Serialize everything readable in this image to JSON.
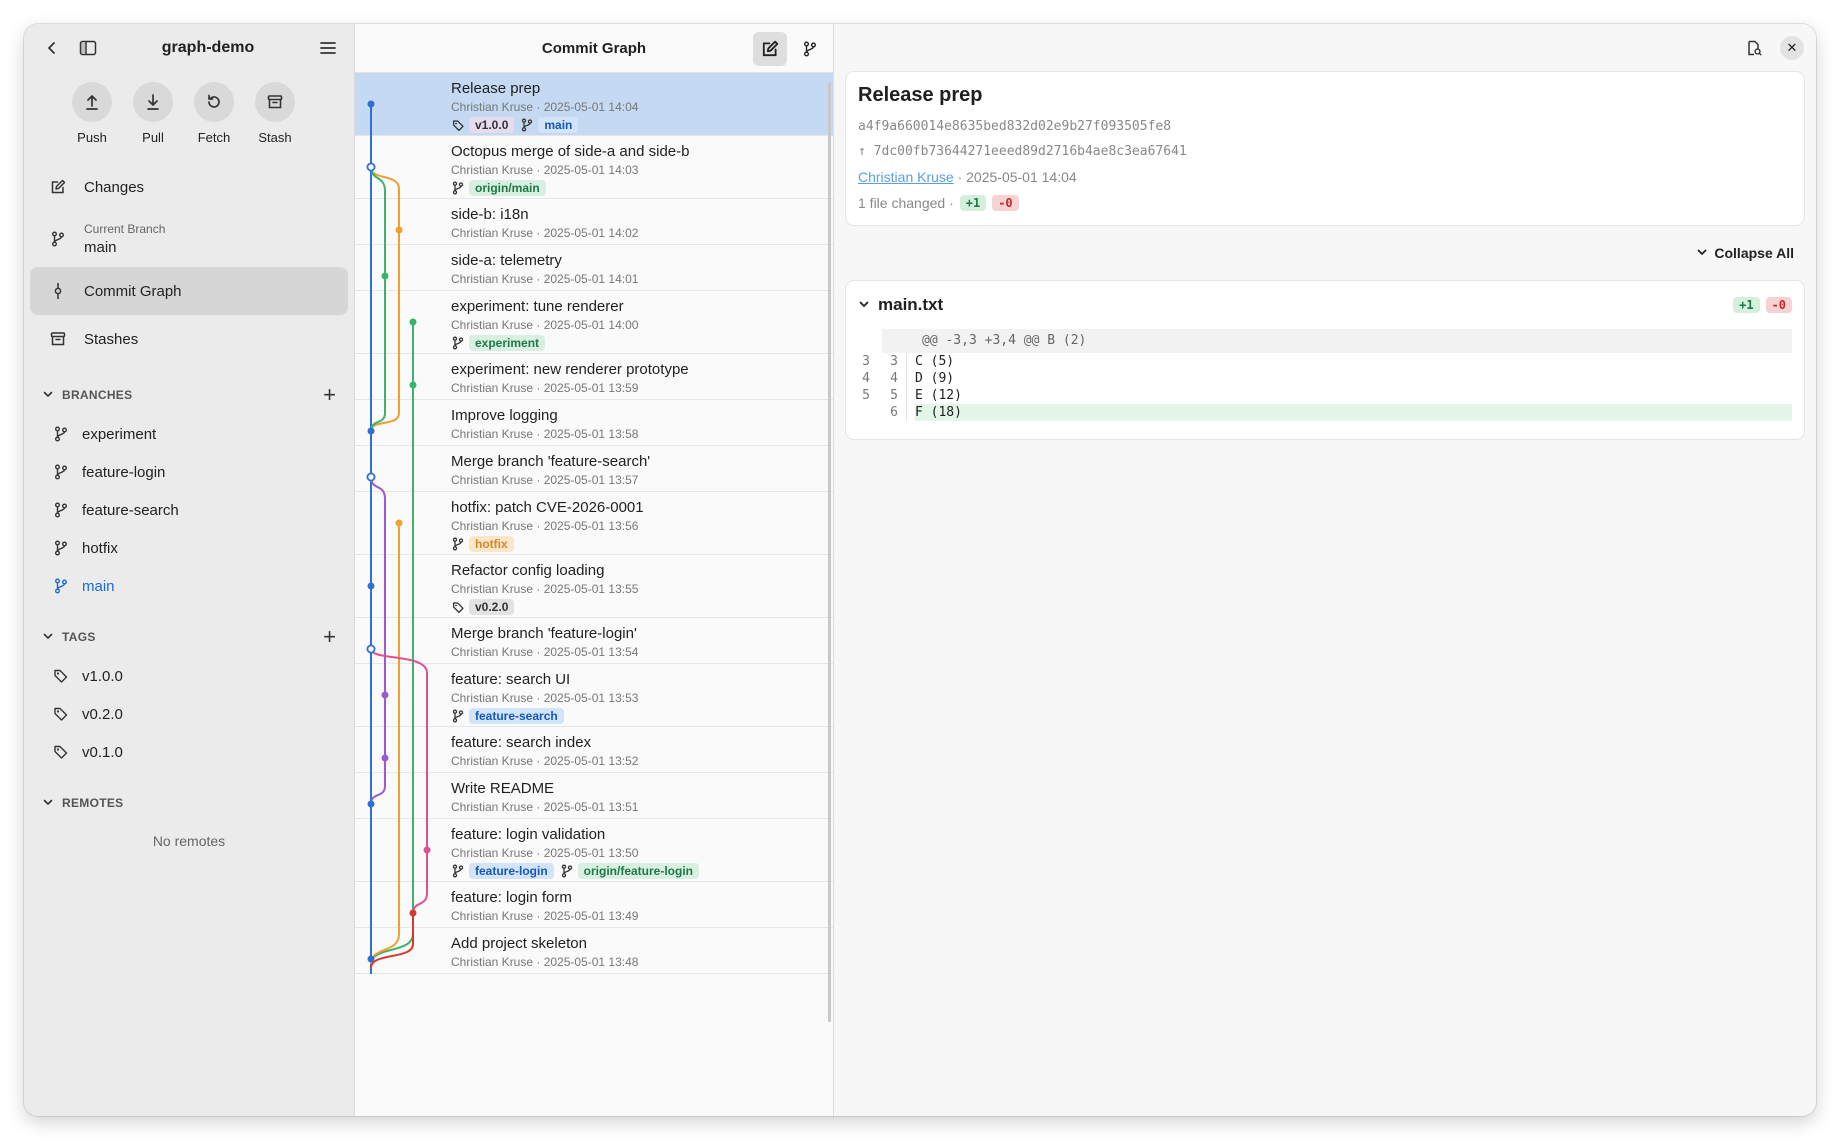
{
  "sidebar": {
    "repo_name": "graph-demo",
    "actions": [
      {
        "label": "Push",
        "icon": "push-icon"
      },
      {
        "label": "Pull",
        "icon": "pull-icon"
      },
      {
        "label": "Fetch",
        "icon": "fetch-icon"
      },
      {
        "label": "Stash",
        "icon": "stash-icon"
      }
    ],
    "nav": {
      "changes": "Changes",
      "current_branch_caption": "Current Branch",
      "current_branch": "main",
      "commit_graph": "Commit Graph",
      "stashes": "Stashes"
    },
    "branches_header": "BRANCHES",
    "branches": [
      "experiment",
      "feature-login",
      "feature-search",
      "hotfix",
      "main"
    ],
    "tags_header": "TAGS",
    "tags": [
      "v1.0.0",
      "v0.2.0",
      "v0.1.0"
    ],
    "remotes_header": "REMOTES",
    "no_remotes": "No remotes"
  },
  "graph": {
    "title": "Commit Graph",
    "commits": [
      {
        "title": "Release prep",
        "meta": "Christian Kruse · 2025-05-01 14:04",
        "refs": [
          {
            "kind": "tag",
            "name": "v1.0.0",
            "style": "purple"
          },
          {
            "kind": "branch",
            "name": "main",
            "style": "blue"
          }
        ]
      },
      {
        "title": "Octopus merge of side-a and side-b",
        "meta": "Christian Kruse · 2025-05-01 14:03",
        "refs": [
          {
            "kind": "branch",
            "name": "origin/main",
            "style": "green"
          }
        ]
      },
      {
        "title": "side-b: i18n",
        "meta": "Christian Kruse · 2025-05-01 14:02",
        "refs": []
      },
      {
        "title": "side-a: telemetry",
        "meta": "Christian Kruse · 2025-05-01 14:01",
        "refs": []
      },
      {
        "title": "experiment: tune renderer",
        "meta": "Christian Kruse · 2025-05-01 14:00",
        "refs": [
          {
            "kind": "branch",
            "name": "experiment",
            "style": "green"
          }
        ]
      },
      {
        "title": "experiment: new renderer prototype",
        "meta": "Christian Kruse · 2025-05-01 13:59",
        "refs": []
      },
      {
        "title": "Improve logging",
        "meta": "Christian Kruse · 2025-05-01 13:58",
        "refs": []
      },
      {
        "title": "Merge branch 'feature-search'",
        "meta": "Christian Kruse · 2025-05-01 13:57",
        "refs": []
      },
      {
        "title": "hotfix: patch CVE-2026-0001",
        "meta": "Christian Kruse · 2025-05-01 13:56",
        "refs": [
          {
            "kind": "branch",
            "name": "hotfix",
            "style": "orange"
          }
        ]
      },
      {
        "title": "Refactor config loading",
        "meta": "Christian Kruse · 2025-05-01 13:55",
        "refs": [
          {
            "kind": "tag",
            "name": "v0.2.0",
            "style": "grey"
          }
        ]
      },
      {
        "title": "Merge branch 'feature-login'",
        "meta": "Christian Kruse · 2025-05-01 13:54",
        "refs": []
      },
      {
        "title": "feature: search UI",
        "meta": "Christian Kruse · 2025-05-01 13:53",
        "refs": [
          {
            "kind": "branch",
            "name": "feature-search",
            "style": "blue"
          }
        ]
      },
      {
        "title": "feature: search index",
        "meta": "Christian Kruse · 2025-05-01 13:52",
        "refs": []
      },
      {
        "title": "Write README",
        "meta": "Christian Kruse · 2025-05-01 13:51",
        "refs": []
      },
      {
        "title": "feature: login validation",
        "meta": "Christian Kruse · 2025-05-01 13:50",
        "refs": [
          {
            "kind": "branch",
            "name": "feature-login",
            "style": "blue"
          },
          {
            "kind": "branch",
            "name": "origin/feature-login",
            "style": "green"
          }
        ]
      },
      {
        "title": "feature: login form",
        "meta": "Christian Kruse · 2025-05-01 13:49",
        "refs": []
      },
      {
        "title": "Add project skeleton",
        "meta": "Christian Kruse · 2025-05-01 13:48",
        "refs": []
      }
    ]
  },
  "detail": {
    "title": "Release prep",
    "sha": "a4f9a660014e8635bed832d02e9b27f093505fe8",
    "parent": "↑ 7dc00fb73644271eeed89d2716b4ae8c3ea67641",
    "author": "Christian Kruse",
    "date": " · 2025-05-01 14:04",
    "files_changed": "1 file changed ·",
    "additions": "+1",
    "deletions": "-0",
    "collapse_all": "Collapse All",
    "file": {
      "name": "main.txt",
      "additions": "+1",
      "deletions": "-0",
      "hunk_header": "@@ -3,3 +3,4 @@ B (2)",
      "lines": [
        {
          "old": "3",
          "new": "3",
          "text": "C (5)",
          "type": "context"
        },
        {
          "old": "4",
          "new": "4",
          "text": "D (9)",
          "type": "context"
        },
        {
          "old": "5",
          "new": "5",
          "text": "E (12)",
          "type": "context"
        },
        {
          "old": "",
          "new": "6",
          "text": "F (18)",
          "type": "add"
        }
      ]
    }
  },
  "colors": {
    "lane_main": "#2f6fd6",
    "lane_green": "#3bb36b",
    "lane_orange": "#f0a030",
    "lane_purple": "#9a5ad2",
    "lane_pink": "#e0508f",
    "lane_red": "#d63a2e",
    "selection": "#c5d9f2"
  }
}
